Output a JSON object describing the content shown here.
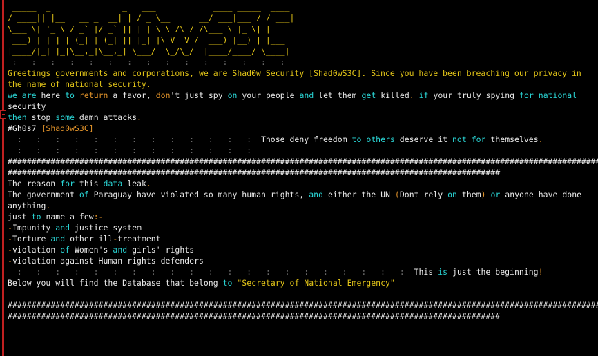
{
  "ascii_art": [
    " _____  _               _   ___            ____ _____  ____ ",
    "/ ____|| |__   __ _  __| | / _ \\__      __/ ___|___ / / ___|",
    "\\___ \\| '_ \\ / _` |/ _` || | | \\ \\ /\\ / /\\___ \\ |_ \\| |    ",
    " ___) | | | | (_| | (_| || |_| |\\ V  V /  ___) |__) | |___ ",
    "|____/|_| |_|\\__,_|\\__,_| \\___/  \\_/\\_/  |____/____/ \\____|",
    " :   :   :   :   :   :   :   :   :   :   :   :   :   :   : "
  ],
  "lines": {
    "l1_greet": "Greetings governments and corporations, we are Shad0w Security [Shad0wS3C]. Since you have been breaching our privacy in",
    "l2_cont": "the name of national security.",
    "l3_a": "we are here to return a favor, don't just spy on your people and let them get killed. if your truly spying for national",
    "l4_security": "security",
    "l5_then": "then",
    "l5_stop": "stop",
    "l5_some": "some",
    "l5_rest": "damn attacks",
    "l5_dot": ".",
    "l6_tag": "#Gh0s7",
    "l6_sig": "[Shad0wS3C]",
    "l7_quote_a": "Those deny freedom",
    "l7_to": "to",
    "l7_others": "others",
    "l7_quote_b": "deserve it",
    "l7_not": "not",
    "l7_for": "for",
    "l7_quote_c": "themselves",
    "l7_dot": ".",
    "hash_full": "##############################################################################################################################",
    "hash_short": "#######################################################################################################",
    "reason_a": "The reason",
    "reason_for": "for",
    "reason_this": "this",
    "reason_data": "data",
    "reason_leak": "leak",
    "reason_dot": ".",
    "gov_a": "The government",
    "gov_of": "of",
    "gov_b": "Paraguay have violated so many human rights,",
    "gov_and": "and",
    "gov_c": "either the UN",
    "gov_paren_open": "(",
    "gov_d": "Dont rely",
    "gov_on": "on",
    "gov_them": "them",
    "gov_paren_close": ")",
    "gov_or": "or",
    "gov_e": "anyone have done",
    "gov_anything": "anything",
    "gov_dot": ".",
    "just_a": "just",
    "just_to": "to",
    "just_b": "name a few",
    "just_colon": ":-",
    "item1_dash": "-",
    "item1_a": "Impunity",
    "item1_and": "and",
    "item1_b": "justice system",
    "item2_dash": "-",
    "item2_a": "Torture",
    "item2_and": "and",
    "item2_b": "other ill",
    "item2_dash2": "-",
    "item2_c": "treatment",
    "item3_dash": "-",
    "item3_a": "violation",
    "item3_of": "of",
    "item3_b": "Women's",
    "item3_and": "and",
    "item3_c": "girls' rights",
    "item4_dash": "-",
    "item4_a": "violation against Human rights defenders",
    "begin_this": "This",
    "begin_is": "is",
    "begin_b": "just the beginning",
    "begin_excl": "!",
    "below_a": "Below you will find the Database that belong",
    "below_to": "to",
    "below_b": "\"Secretary of National Emergency\""
  },
  "colors": {
    "background": "#000000",
    "text": "#e8e8e8",
    "yellow": "#e2c418",
    "cyan": "#2ad6d6",
    "orange": "#e0922a",
    "gutter": "#c02020"
  }
}
